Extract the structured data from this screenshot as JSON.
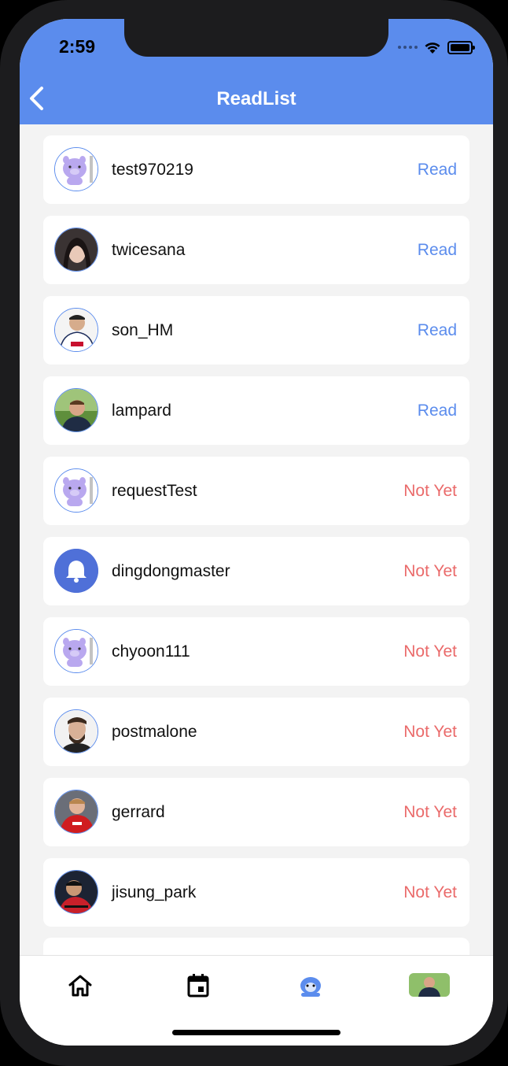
{
  "status_bar": {
    "time": "2:59"
  },
  "header": {
    "title": "ReadList"
  },
  "readers": [
    {
      "name": "test970219",
      "status": "Read",
      "status_type": "read",
      "avatar": "pig"
    },
    {
      "name": "twicesana",
      "status": "Read",
      "status_type": "read",
      "avatar": "person-dark-hair"
    },
    {
      "name": "son_HM",
      "status": "Read",
      "status_type": "read",
      "avatar": "person-white-jersey"
    },
    {
      "name": "lampard",
      "status": "Read",
      "status_type": "read",
      "avatar": "person-grass"
    },
    {
      "name": "requestTest",
      "status": "Not Yet",
      "status_type": "notyet",
      "avatar": "pig"
    },
    {
      "name": "dingdongmaster",
      "status": "Not Yet",
      "status_type": "notyet",
      "avatar": "bell"
    },
    {
      "name": "chyoon111",
      "status": "Not Yet",
      "status_type": "notyet",
      "avatar": "pig"
    },
    {
      "name": "postmalone",
      "status": "Not Yet",
      "status_type": "notyet",
      "avatar": "person-beard"
    },
    {
      "name": "gerrard",
      "status": "Not Yet",
      "status_type": "notyet",
      "avatar": "person-red-jersey"
    },
    {
      "name": "jisung_park",
      "status": "Not Yet",
      "status_type": "notyet",
      "avatar": "person-dark-jersey"
    }
  ],
  "colors": {
    "accent": "#5b8ced",
    "read": "#5b8ced",
    "not_yet": "#ea6a6a"
  },
  "tabbar": {
    "tabs": [
      {
        "icon": "home-icon"
      },
      {
        "icon": "calendar-icon"
      },
      {
        "icon": "mascot-icon",
        "active": true
      },
      {
        "icon": "profile-avatar"
      }
    ]
  }
}
